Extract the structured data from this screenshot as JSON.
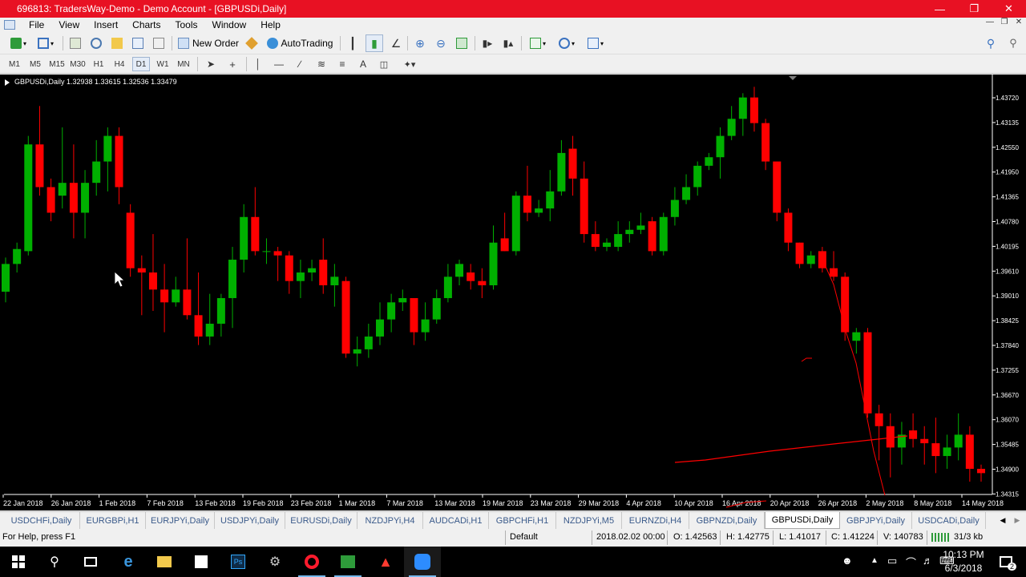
{
  "window": {
    "title": "696813: TradersWay-Demo - Demo Account - [GBPUSDi,Daily]"
  },
  "menu": [
    "File",
    "View",
    "Insert",
    "Charts",
    "Tools",
    "Window",
    "Help"
  ],
  "toolbar": {
    "new_order": "New Order",
    "autotrading": "AutoTrading"
  },
  "timeframes": [
    "M1",
    "M5",
    "M15",
    "M30",
    "H1",
    "H4",
    "D1",
    "W1",
    "MN"
  ],
  "active_timeframe": "D1",
  "chart": {
    "header": "GBPUSDi,Daily  1.32938 1.33615 1.32536 1.33479",
    "price_labels": [
      "1.43720",
      "1.43135",
      "1.42550",
      "1.41950",
      "1.41365",
      "1.40780",
      "1.40195",
      "1.39610",
      "1.39010",
      "1.38425",
      "1.37840",
      "1.37255",
      "1.36670",
      "1.36070",
      "1.35485",
      "1.34900",
      "1.34315"
    ],
    "date_labels": [
      "22 Jan 2018",
      "26 Jan 2018",
      "1 Feb 2018",
      "7 Feb 2018",
      "13 Feb 2018",
      "19 Feb 2018",
      "23 Feb 2018",
      "1 Mar 2018",
      "7 Mar 2018",
      "13 Mar 2018",
      "19 Mar 2018",
      "23 Mar 2018",
      "29 Mar 2018",
      "4 Apr 2018",
      "10 Apr 2018",
      "16 Apr 2018",
      "20 Apr 2018",
      "26 Apr 2018",
      "2 May 2018",
      "8 May 2018",
      "14 May 2018"
    ],
    "colors": {
      "bull": "#00b000",
      "bear": "#ff0000",
      "background": "#000000",
      "text": "#ffffff"
    }
  },
  "chart_data": {
    "type": "candlestick",
    "symbol": "GBPUSDi",
    "period": "Daily",
    "ylim": [
      1.342,
      1.44
    ],
    "candles": [
      {
        "o": 1.3895,
        "h": 1.3975,
        "l": 1.387,
        "c": 1.396
      },
      {
        "o": 1.396,
        "h": 1.401,
        "l": 1.394,
        "c": 1.3995
      },
      {
        "o": 1.399,
        "h": 1.426,
        "l": 1.398,
        "c": 1.424
      },
      {
        "o": 1.424,
        "h": 1.433,
        "l": 1.412,
        "c": 1.414
      },
      {
        "o": 1.414,
        "h": 1.416,
        "l": 1.406,
        "c": 1.408
      },
      {
        "o": 1.412,
        "h": 1.428,
        "l": 1.409,
        "c": 1.415
      },
      {
        "o": 1.415,
        "h": 1.424,
        "l": 1.402,
        "c": 1.408
      },
      {
        "o": 1.408,
        "h": 1.418,
        "l": 1.402,
        "c": 1.415
      },
      {
        "o": 1.415,
        "h": 1.425,
        "l": 1.412,
        "c": 1.42
      },
      {
        "o": 1.42,
        "h": 1.428,
        "l": 1.413,
        "c": 1.426
      },
      {
        "o": 1.426,
        "h": 1.428,
        "l": 1.41,
        "c": 1.414
      },
      {
        "o": 1.408,
        "h": 1.41,
        "l": 1.393,
        "c": 1.395
      },
      {
        "o": 1.395,
        "h": 1.398,
        "l": 1.384,
        "c": 1.394
      },
      {
        "o": 1.394,
        "h": 1.403,
        "l": 1.385,
        "c": 1.39
      },
      {
        "o": 1.39,
        "h": 1.396,
        "l": 1.38,
        "c": 1.387
      },
      {
        "o": 1.387,
        "h": 1.393,
        "l": 1.386,
        "c": 1.39
      },
      {
        "o": 1.39,
        "h": 1.402,
        "l": 1.383,
        "c": 1.384
      },
      {
        "o": 1.384,
        "h": 1.394,
        "l": 1.377,
        "c": 1.379
      },
      {
        "o": 1.379,
        "h": 1.389,
        "l": 1.377,
        "c": 1.382
      },
      {
        "o": 1.382,
        "h": 1.389,
        "l": 1.379,
        "c": 1.388
      },
      {
        "o": 1.388,
        "h": 1.4,
        "l": 1.381,
        "c": 1.397
      },
      {
        "o": 1.397,
        "h": 1.41,
        "l": 1.394,
        "c": 1.407
      },
      {
        "o": 1.407,
        "h": 1.414,
        "l": 1.398,
        "c": 1.399
      },
      {
        "o": 1.399,
        "h": 1.402,
        "l": 1.396,
        "c": 1.399
      },
      {
        "o": 1.399,
        "h": 1.4,
        "l": 1.392,
        "c": 1.398
      },
      {
        "o": 1.398,
        "h": 1.399,
        "l": 1.389,
        "c": 1.392
      },
      {
        "o": 1.392,
        "h": 1.397,
        "l": 1.388,
        "c": 1.394
      },
      {
        "o": 1.394,
        "h": 1.397,
        "l": 1.392,
        "c": 1.395
      },
      {
        "o": 1.397,
        "h": 1.402,
        "l": 1.389,
        "c": 1.391
      },
      {
        "o": 1.391,
        "h": 1.396,
        "l": 1.386,
        "c": 1.393
      },
      {
        "o": 1.392,
        "h": 1.393,
        "l": 1.374,
        "c": 1.375
      },
      {
        "o": 1.375,
        "h": 1.379,
        "l": 1.372,
        "c": 1.376
      },
      {
        "o": 1.376,
        "h": 1.382,
        "l": 1.374,
        "c": 1.379
      },
      {
        "o": 1.379,
        "h": 1.387,
        "l": 1.377,
        "c": 1.383
      },
      {
        "o": 1.383,
        "h": 1.389,
        "l": 1.38,
        "c": 1.387
      },
      {
        "o": 1.387,
        "h": 1.39,
        "l": 1.385,
        "c": 1.388
      },
      {
        "o": 1.388,
        "h": 1.388,
        "l": 1.377,
        "c": 1.38
      },
      {
        "o": 1.38,
        "h": 1.387,
        "l": 1.378,
        "c": 1.383
      },
      {
        "o": 1.383,
        "h": 1.39,
        "l": 1.382,
        "c": 1.388
      },
      {
        "o": 1.388,
        "h": 1.396,
        "l": 1.387,
        "c": 1.393
      },
      {
        "o": 1.393,
        "h": 1.397,
        "l": 1.391,
        "c": 1.396
      },
      {
        "o": 1.394,
        "h": 1.396,
        "l": 1.39,
        "c": 1.392
      },
      {
        "o": 1.392,
        "h": 1.395,
        "l": 1.388,
        "c": 1.391
      },
      {
        "o": 1.391,
        "h": 1.405,
        "l": 1.39,
        "c": 1.401
      },
      {
        "o": 1.402,
        "h": 1.408,
        "l": 1.399,
        "c": 1.399
      },
      {
        "o": 1.399,
        "h": 1.413,
        "l": 1.398,
        "c": 1.412
      },
      {
        "o": 1.412,
        "h": 1.419,
        "l": 1.406,
        "c": 1.408
      },
      {
        "o": 1.408,
        "h": 1.411,
        "l": 1.407,
        "c": 1.409
      },
      {
        "o": 1.409,
        "h": 1.418,
        "l": 1.406,
        "c": 1.413
      },
      {
        "o": 1.413,
        "h": 1.425,
        "l": 1.412,
        "c": 1.422
      },
      {
        "o": 1.423,
        "h": 1.426,
        "l": 1.412,
        "c": 1.416
      },
      {
        "o": 1.416,
        "h": 1.42,
        "l": 1.401,
        "c": 1.403
      },
      {
        "o": 1.403,
        "h": 1.406,
        "l": 1.399,
        "c": 1.4
      },
      {
        "o": 1.4,
        "h": 1.402,
        "l": 1.399,
        "c": 1.401
      },
      {
        "o": 1.4,
        "h": 1.406,
        "l": 1.399,
        "c": 1.403
      },
      {
        "o": 1.403,
        "h": 1.406,
        "l": 1.401,
        "c": 1.404
      },
      {
        "o": 1.404,
        "h": 1.408,
        "l": 1.403,
        "c": 1.405
      },
      {
        "o": 1.406,
        "h": 1.407,
        "l": 1.398,
        "c": 1.399
      },
      {
        "o": 1.399,
        "h": 1.408,
        "l": 1.398,
        "c": 1.407
      },
      {
        "o": 1.407,
        "h": 1.414,
        "l": 1.405,
        "c": 1.411
      },
      {
        "o": 1.411,
        "h": 1.417,
        "l": 1.41,
        "c": 1.414
      },
      {
        "o": 1.414,
        "h": 1.42,
        "l": 1.412,
        "c": 1.419
      },
      {
        "o": 1.419,
        "h": 1.422,
        "l": 1.418,
        "c": 1.421
      },
      {
        "o": 1.421,
        "h": 1.428,
        "l": 1.416,
        "c": 1.426
      },
      {
        "o": 1.426,
        "h": 1.433,
        "l": 1.425,
        "c": 1.43
      },
      {
        "o": 1.43,
        "h": 1.436,
        "l": 1.426,
        "c": 1.435
      },
      {
        "o": 1.435,
        "h": 1.4375,
        "l": 1.427,
        "c": 1.429
      },
      {
        "o": 1.429,
        "h": 1.43,
        "l": 1.418,
        "c": 1.42
      },
      {
        "o": 1.42,
        "h": 1.42,
        "l": 1.406,
        "c": 1.408
      },
      {
        "o": 1.408,
        "h": 1.409,
        "l": 1.399,
        "c": 1.401
      },
      {
        "o": 1.401,
        "h": 1.401,
        "l": 1.395,
        "c": 1.396
      },
      {
        "o": 1.396,
        "h": 1.399,
        "l": 1.395,
        "c": 1.398
      },
      {
        "o": 1.399,
        "h": 1.4,
        "l": 1.394,
        "c": 1.395
      },
      {
        "o": 1.395,
        "h": 1.399,
        "l": 1.392,
        "c": 1.393
      },
      {
        "o": 1.393,
        "h": 1.394,
        "l": 1.378,
        "c": 1.38
      },
      {
        "o": 1.378,
        "h": 1.381,
        "l": 1.375,
        "c": 1.38
      },
      {
        "o": 1.38,
        "h": 1.381,
        "l": 1.36,
        "c": 1.361
      },
      {
        "o": 1.361,
        "h": 1.363,
        "l": 1.35,
        "c": 1.358
      },
      {
        "o": 1.358,
        "h": 1.361,
        "l": 1.346,
        "c": 1.353
      },
      {
        "o": 1.353,
        "h": 1.359,
        "l": 1.349,
        "c": 1.356
      },
      {
        "o": 1.357,
        "h": 1.361,
        "l": 1.353,
        "c": 1.355
      },
      {
        "o": 1.355,
        "h": 1.358,
        "l": 1.349,
        "c": 1.354
      },
      {
        "o": 1.354,
        "h": 1.36,
        "l": 1.347,
        "c": 1.351
      },
      {
        "o": 1.351,
        "h": 1.356,
        "l": 1.348,
        "c": 1.353
      },
      {
        "o": 1.353,
        "h": 1.361,
        "l": 1.35,
        "c": 1.356
      },
      {
        "o": 1.356,
        "h": 1.358,
        "l": 1.345,
        "c": 1.348
      },
      {
        "o": 1.348,
        "h": 1.349,
        "l": 1.345,
        "c": 1.347
      }
    ]
  },
  "tabs": [
    "USDCHFi,Daily",
    "EURGBPi,H1",
    "EURJPYi,Daily",
    "USDJPYi,Daily",
    "EURUSDi,Daily",
    "NZDJPYi,H4",
    "AUDCADi,H1",
    "GBPCHFi,H1",
    "NZDJPYi,M5",
    "EURNZDi,H4",
    "GBPNZDi,Daily",
    "GBPUSDi,Daily",
    "GBPJPYi,Daily",
    "USDCADi,Daily"
  ],
  "active_tab": "GBPUSDi,Daily",
  "status": {
    "help": "For Help, press F1",
    "profile": "Default",
    "datetime": "2018.02.02 00:00",
    "open": "O: 1.42563",
    "high": "H: 1.42775",
    "low": "L: 1.41017",
    "close": "C: 1.41224",
    "volume": "V: 140783",
    "traffic": "31/3 kb"
  },
  "taskbar": {
    "time": "10:13 PM",
    "date": "6/3/2018",
    "notifications": "2"
  }
}
